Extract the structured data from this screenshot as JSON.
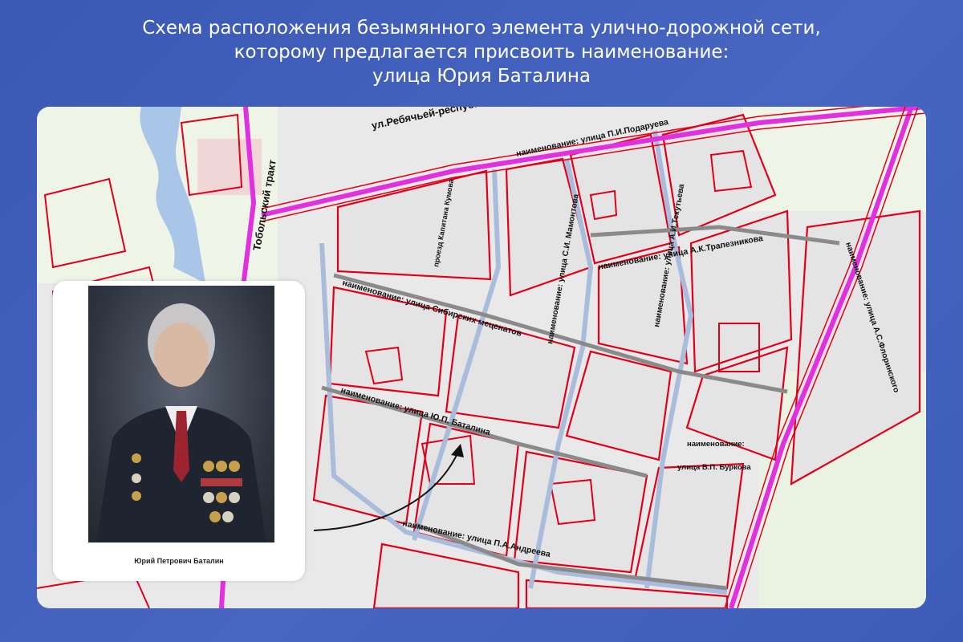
{
  "header": {
    "line1": "Схема расположения безымянного элемента улично-дорожной сети,",
    "line2": "которому предлагается присвоить наименование:",
    "line3": "улица Юрия Баталина"
  },
  "map": {
    "labels": {
      "rebyachey": "ул.Ребячьей-респуб...",
      "tobolsky": "Тобольский тракт",
      "podarueva": "наименование: улица П.И.Подаруева",
      "proezd_kumov": "проезд Капитана Кумова",
      "trapeznikova": "наименование: улица А.К.Трапезникова",
      "sibirskih": "наименование: улица Сибирских меценатов",
      "batalina": "наименование: улица Ю.П. Баталина",
      "mamontova": "наименование: улица С.И. Мамонтова",
      "tekutyeva": "наименование: улица А.И.Текутьева",
      "burkova_1": "наименование:",
      "burkova_2": "улица В.П. Буркова",
      "florinskogo": "наименование: улица А.С.Флоринского",
      "andreeva": "наименование: улица П.А.Андреева"
    },
    "colors": {
      "boundary": "#e0001a",
      "main_road": "#e030e0",
      "street_fill": "#b9c6df",
      "block": "#e6e6e6",
      "water": "#a9c6e8"
    }
  },
  "photo": {
    "caption": "Юрий Петрович Баталин"
  }
}
